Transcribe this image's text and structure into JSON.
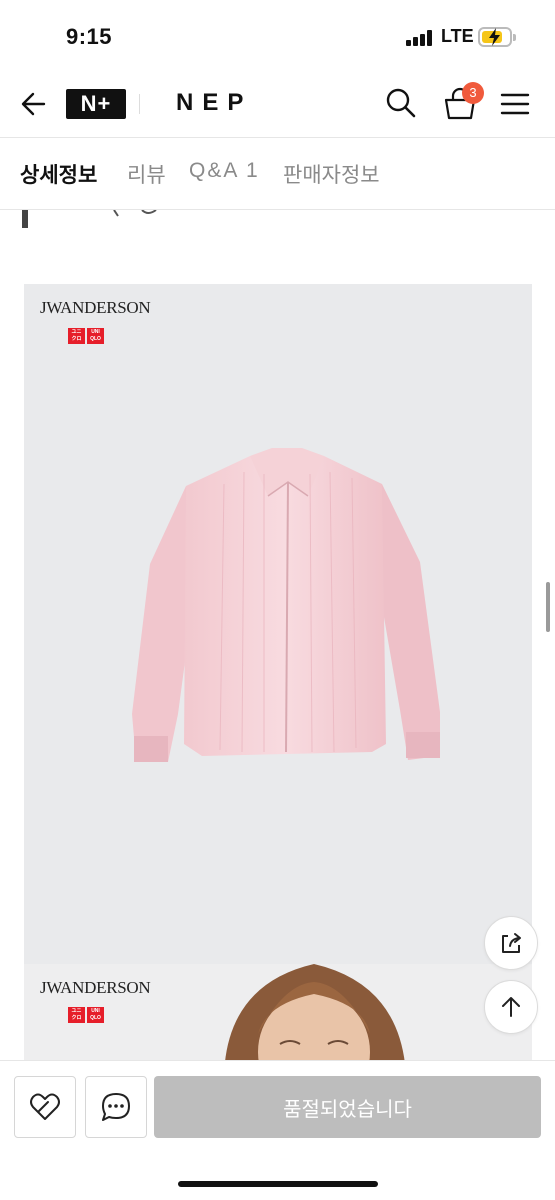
{
  "status_bar": {
    "time": "9:15",
    "network": "LTE"
  },
  "header": {
    "logo_text": "N+",
    "brand": "NEP",
    "cart_count": "3"
  },
  "tabs": [
    {
      "label": "상세정보",
      "active": true
    },
    {
      "label": "리뷰",
      "active": false
    },
    {
      "label": "Q&A 1",
      "active": false
    },
    {
      "label": "판매자정보",
      "active": false
    }
  ],
  "content": {
    "jw_logo": "JWANDERSON",
    "uniqlo_logo": "UNIQLO",
    "product_color": "#f6d4d9"
  },
  "bottom_bar": {
    "soldout_label": "품절되었습니다"
  },
  "colors": {
    "accent_badge": "#f05a3c",
    "disabled_button": "#bdbdbd"
  },
  "icons": [
    "back-arrow-icon",
    "search-icon",
    "shopping-bag-icon",
    "hamburger-menu-icon",
    "share-icon",
    "arrow-up-icon",
    "heart-icon",
    "chat-bubble-icon"
  ]
}
